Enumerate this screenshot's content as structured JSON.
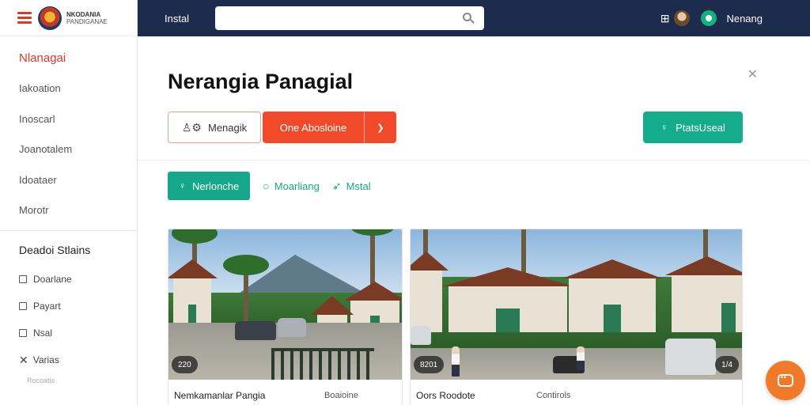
{
  "brand": {
    "title": "NKODANIA",
    "subtitle": "PANDIGANAE"
  },
  "sidebar": {
    "items": [
      {
        "label": "Nlanagai",
        "active": true
      },
      {
        "label": "Iakoation",
        "active": false
      },
      {
        "label": "Inoscarl",
        "active": false
      },
      {
        "label": "Joanotalem",
        "active": false
      },
      {
        "label": "Idoataer",
        "active": false
      },
      {
        "label": "Morotr",
        "active": false
      }
    ],
    "section_title": "Deadoi Stlains",
    "section_items": [
      {
        "label": "Doarlane",
        "icon": "square-icon"
      },
      {
        "label": "Payart",
        "icon": "square-icon"
      },
      {
        "label": "Nsal",
        "icon": "square-icon"
      },
      {
        "label": "Varias",
        "icon": "x-icon"
      }
    ],
    "footer_text": "Rocoatis"
  },
  "header": {
    "label": "Instal",
    "search_placeholder": "",
    "user_name": "Nenang"
  },
  "main": {
    "title": "Nerangia Panagial",
    "buttons": {
      "outline_label": "Menagik",
      "primary_label": "One Abosloine",
      "teal_label": "PtatsUseal"
    },
    "filters": {
      "active": "Nerlonche",
      "items": [
        "Moarliang",
        "Mstal"
      ]
    },
    "cards": [
      {
        "title": "Nemkamanlar Pangia",
        "meta": "Boaioine",
        "tag": "220"
      },
      {
        "title": "Oors Roodote",
        "meta": "Contirols",
        "tag": "8201",
        "tag2": "1/4"
      }
    ]
  },
  "colors": {
    "header_bg": "#1d2b4d",
    "accent_red": "#f04a2a",
    "accent_teal": "#15ac8b",
    "fab_orange": "#f07a2a"
  }
}
